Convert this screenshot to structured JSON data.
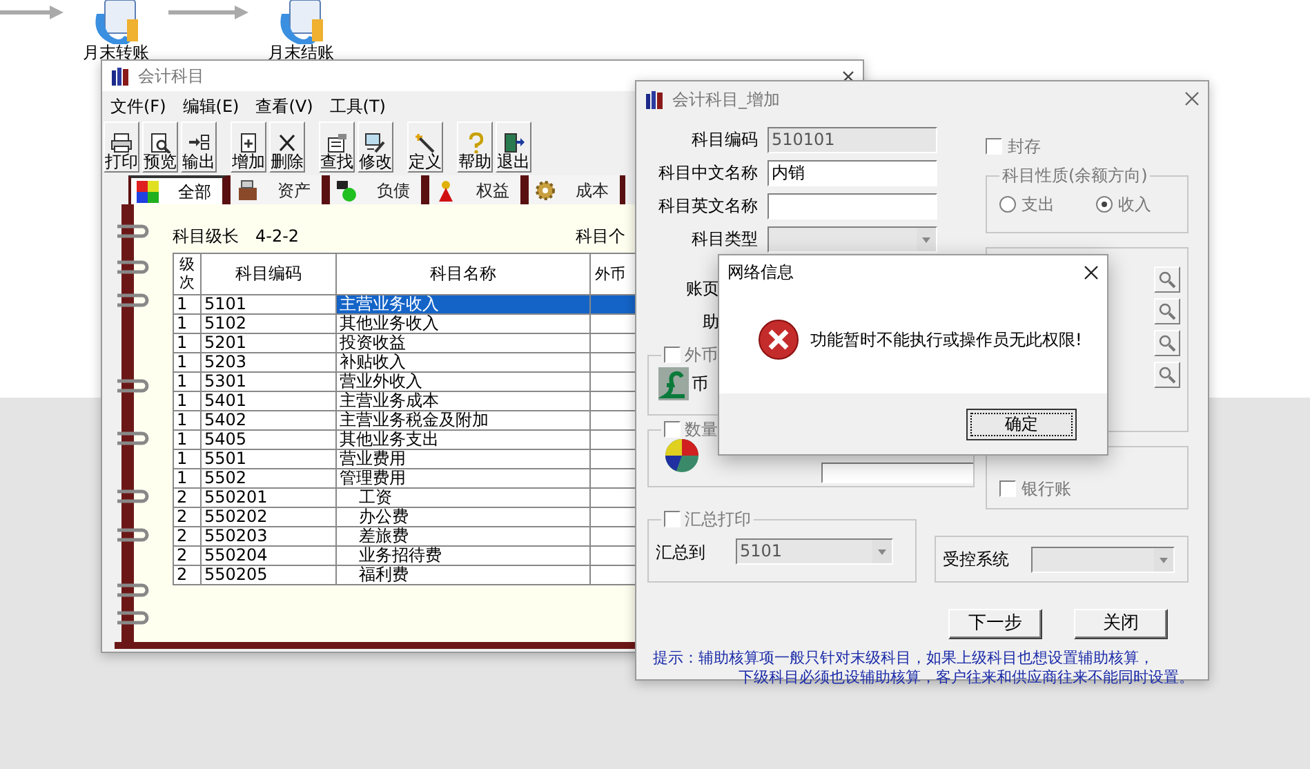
{
  "desktop": {
    "shortcuts": [
      {
        "label": "月末转账"
      },
      {
        "label": "月末结账"
      }
    ]
  },
  "account_window": {
    "title": "会计科目",
    "menu": [
      "文件(F)",
      "编辑(E)",
      "查看(V)",
      "工具(T)"
    ],
    "toolbar": [
      [
        "打印",
        "预览",
        "输出"
      ],
      [
        "增加",
        "删除"
      ],
      [
        "查找",
        "修改"
      ],
      [
        "定义"
      ],
      [
        "帮助",
        "退出"
      ]
    ],
    "tabs": [
      {
        "label": "全部",
        "selected": true
      },
      {
        "label": "资产",
        "selected": false
      },
      {
        "label": "负债",
        "selected": false
      },
      {
        "label": "权益",
        "selected": false
      },
      {
        "label": "成本",
        "selected": false
      }
    ],
    "level_length": {
      "label": "科目级长",
      "value": "4-2-2"
    },
    "count_label": "科目个",
    "table": {
      "columns": [
        "级次",
        "科目编码",
        "科目名称",
        "外币"
      ],
      "rows": [
        {
          "level": "1",
          "code": "5101",
          "name": "主营业务收入",
          "selected": true
        },
        {
          "level": "1",
          "code": "5102",
          "name": "其他业务收入",
          "selected": false
        },
        {
          "level": "1",
          "code": "5201",
          "name": "投资收益",
          "selected": false
        },
        {
          "level": "1",
          "code": "5203",
          "name": "补贴收入",
          "selected": false
        },
        {
          "level": "1",
          "code": "5301",
          "name": "营业外收入",
          "selected": false
        },
        {
          "level": "1",
          "code": "5401",
          "name": "主营业务成本",
          "selected": false
        },
        {
          "level": "1",
          "code": "5402",
          "name": "主营业务税金及附加",
          "selected": false
        },
        {
          "level": "1",
          "code": "5405",
          "name": "其他业务支出",
          "selected": false
        },
        {
          "level": "1",
          "code": "5501",
          "name": "营业费用",
          "selected": false
        },
        {
          "level": "1",
          "code": "5502",
          "name": "管理费用",
          "selected": false,
          "children": [
            {
              "level": "2",
              "code": "550201",
              "name": "工资",
              "selected": false
            },
            {
              "level": "2",
              "code": "550202",
              "name": "办公费",
              "selected": false
            },
            {
              "level": "2",
              "code": "550203",
              "name": "差旅费",
              "selected": false
            },
            {
              "level": "2",
              "code": "550204",
              "name": "业务招待费",
              "selected": false
            },
            {
              "level": "2",
              "code": "550205",
              "name": "福利费",
              "selected": false
            }
          ]
        }
      ]
    }
  },
  "add_dialog": {
    "title": "会计科目_增加",
    "fields": [
      {
        "label": "科目编码",
        "kind": "text",
        "value": "510101",
        "disabled": true
      },
      {
        "label": "科目中文名称",
        "kind": "text",
        "value": "内销",
        "disabled": false
      },
      {
        "label": "科目英文名称",
        "kind": "text",
        "disabled": false
      },
      {
        "label": "科目类型",
        "kind": "select",
        "disabled": true
      }
    ],
    "covered_labels": [
      "账页",
      "助"
    ],
    "sealed": {
      "label": "封存",
      "checked": false
    },
    "nature": {
      "title": "科目性质(余额方向)",
      "options": [
        {
          "label": "支出",
          "selected": false
        },
        {
          "label": "收入",
          "selected": true
        }
      ]
    },
    "foreign_currency": {
      "label": "外币",
      "checked": false,
      "sublabel": "币"
    },
    "quantity": {
      "label": "数量",
      "checked": false
    },
    "bank_journal": {
      "label": "银行账",
      "checked": false
    },
    "summary_print": {
      "label": "汇总打印",
      "checked": false,
      "target_label": "汇总到",
      "target_value": "5101"
    },
    "controlled_system": {
      "label": "受控系统"
    },
    "buttons": [
      "下一步",
      "关闭"
    ],
    "hint": [
      "提示：辅助核算项一般只针对末级科目，如果上级科目也想设置辅助核算，",
      "下级科目必须也设辅助核算，客户往来和供应商往来不能同时设置。"
    ]
  },
  "message_box": {
    "title": "网络信息",
    "message": "功能暂时不能执行或操作员无此权限!",
    "button": "确定"
  }
}
